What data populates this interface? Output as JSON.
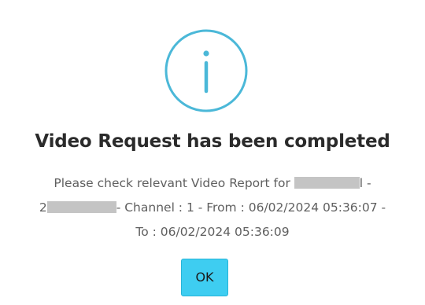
{
  "dialog": {
    "icon": "info-circle-icon",
    "accent_color": "#4bb8d8",
    "title": "Video Request has been completed",
    "message": {
      "line1_prefix": "Please check relevant Video Report for ",
      "line1_suffix": "l -",
      "line2_prefix": "2",
      "line2_suffix": "- Channel : 1 - From : 06/02/2024 05:36:07 -",
      "line3": "To : 06/02/2024 05:36:09"
    },
    "ok_label": "OK",
    "button_color": "#3ecdf1"
  }
}
